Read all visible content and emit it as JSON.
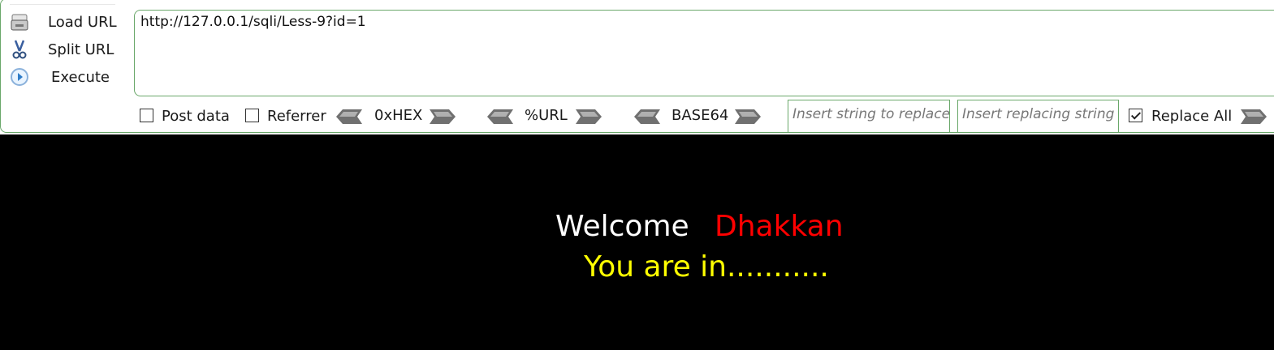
{
  "toolbar": {
    "load_url": "Load URL",
    "split_url": "Split URL",
    "execute": "Execute"
  },
  "url": {
    "value": "http://127.0.0.1/sqli/Less-9?id=1"
  },
  "options": {
    "post_data": "Post data",
    "post_data_checked": false,
    "referrer": "Referrer",
    "referrer_checked": false,
    "hex": "0xHEX",
    "url_encode": "%URL",
    "base64": "BASE64",
    "replace_placeholder": "Insert string to replace",
    "replacing_placeholder": "Insert replacing string",
    "replace_all": "Replace All",
    "replace_all_checked": true
  },
  "page": {
    "welcome": "Welcome",
    "username": "Dhakkan",
    "message": "You are in..........."
  },
  "colors": {
    "border": "#6aa86a",
    "page_background": "#000000",
    "welcome_text": "#ffffff",
    "username_text": "#ff0000",
    "message_text": "#ffff00"
  },
  "icons": {
    "load": "load-url-icon",
    "split": "scissors-icon",
    "execute": "play-icon",
    "encode_left": "left-arrow-icon",
    "encode_right": "right-arrow-icon"
  }
}
